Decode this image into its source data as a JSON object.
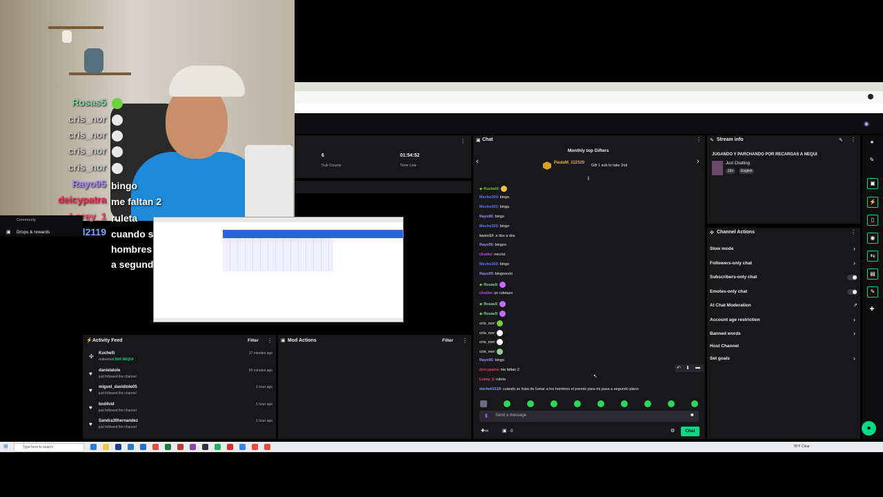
{
  "webcam_overlay": {
    "messages": [
      {
        "user": "Rosas5",
        "text": "",
        "color": "#8bd6a9"
      },
      {
        "user": "cris_nor",
        "text": "",
        "color": "#c9c9c9"
      },
      {
        "user": "cris_nor",
        "text": "",
        "color": "#c9c9c9"
      },
      {
        "user": "cris_nor",
        "text": "",
        "color": "#c9c9c9"
      },
      {
        "user": "cris_nor",
        "text": "",
        "color": "#c9c9c9"
      },
      {
        "user": "Rayo95",
        "text": "bingo",
        "color": "#a58bff"
      },
      {
        "user": "deicypatra",
        "text": "me faltan 2",
        "color": "#ff2d55"
      },
      {
        "user": "Lorey_1",
        "text": "ruleta",
        "color": "#ff4d6d"
      },
      {
        "user": "michell2119",
        "text": "cuando se trata de fumar a los hombres el premio para mi pasa a segundo plano",
        "color": "#7aa8ff"
      }
    ]
  },
  "left_nav": {
    "community": "Community",
    "drops": "Drops & rewards"
  },
  "stats": {
    "sub_counts_value": "6",
    "sub_counts_label": "Sub Counts",
    "time_live_value": "01:54:52",
    "time_live_label": "Time Live"
  },
  "chat": {
    "title": "Chat",
    "top_gifters_title": "Monthly top Gifters",
    "gifter_name": "PaulaM_112320",
    "gifter_note": "Gift 1 sub to take 2nd",
    "lines": [
      {
        "user": "Kuchelli",
        "text": "",
        "color": "#7cc83c"
      },
      {
        "user": "Mecho303",
        "text": "bingo",
        "color": "#5b7fff"
      },
      {
        "user": "Mecho303",
        "text": "bingo",
        "color": "#5b7fff"
      },
      {
        "user": "Rayo95",
        "text": "bingo",
        "color": "#a58bff"
      },
      {
        "user": "Mecho303",
        "text": "bingo",
        "color": "#5b7fff"
      },
      {
        "user": "kasio10",
        "text": "a dos a dos",
        "color": "#c9c9c9"
      },
      {
        "user": "Rayo95",
        "text": "bingoo",
        "color": "#a58bff"
      },
      {
        "user": "chatito",
        "text": "mecho",
        "color": "#c04bff"
      },
      {
        "user": "Mecho303",
        "text": "bingo",
        "color": "#5b7fff"
      },
      {
        "user": "Rayo95",
        "text": "bingooooo",
        "color": "#a58bff"
      },
      {
        "user": "Rosas5",
        "text": "",
        "color": "#8bd6a9"
      },
      {
        "user": "chatito",
        "text": "un ruletazo",
        "color": "#c04bff"
      },
      {
        "user": "Rosas5",
        "text": "",
        "color": "#8bd6a9"
      },
      {
        "user": "Rosas5",
        "text": "",
        "color": "#8bd6a9"
      },
      {
        "user": "cris_nor",
        "text": "",
        "color": "#c9c9c9"
      },
      {
        "user": "cris_nor",
        "text": "",
        "color": "#c9c9c9"
      },
      {
        "user": "cris_nor",
        "text": "",
        "color": "#c9c9c9"
      },
      {
        "user": "cris_nor",
        "text": "",
        "color": "#c9c9c9"
      },
      {
        "user": "Rayo95",
        "text": "bingo",
        "color": "#a58bff"
      },
      {
        "user": "deicypatra",
        "text": "me faltan 2",
        "color": "#ff2d55"
      },
      {
        "user": "Lorey_1",
        "text": "ruleta",
        "color": "#ff4d6d"
      },
      {
        "user": "michell2119",
        "text": "cuando se trata de fumar a los hombres el premio para mi pasa a segundo plano",
        "color": "#7aa8ff"
      }
    ],
    "input_placeholder": "Send a message",
    "points": "0",
    "chat_button": "Chat",
    "accent": "#00db84"
  },
  "stream_info": {
    "title": "Stream info",
    "stream_title": "JUGANDO Y PARCHANDO POR RECARGAS A NEQUI",
    "category": "Just Chatting",
    "tags": [
      "18+",
      "English"
    ]
  },
  "channel_actions": {
    "title": "Channel Actions",
    "items": [
      {
        "label": "Slow mode",
        "control": "chevron"
      },
      {
        "label": "Followers-only chat",
        "control": "chevron"
      },
      {
        "label": "Subscribers-only chat",
        "control": "toggle"
      },
      {
        "label": "Emotes-only chat",
        "control": "toggle"
      },
      {
        "label": "AI Chat Moderation",
        "control": "link"
      },
      {
        "label": "Account age restriction",
        "control": "chevron"
      },
      {
        "label": "Banned words",
        "control": "chevron"
      },
      {
        "label": "Host Channel",
        "control": "none"
      },
      {
        "label": "Set goals",
        "control": "chevron"
      }
    ]
  },
  "activity_feed": {
    "title": "Activity Feed",
    "filter": "Filter",
    "items": [
      {
        "name": "Kuchelli",
        "sub": "redeemed",
        "highlight": "50K NEQUI",
        "time": "37 minutes ago"
      },
      {
        "name": "danielatole",
        "sub": "just followed the channel",
        "highlight": "",
        "time": "55 minutes ago"
      },
      {
        "name": "miguel_davidtole05",
        "sub": "just followed the channel",
        "highlight": "",
        "time": "1 hour ago"
      },
      {
        "name": "bxd4vid",
        "sub": "just followed the channel",
        "highlight": "",
        "time": "1 hour ago"
      },
      {
        "name": "Sandra30hernandez",
        "sub": "just followed the channel",
        "highlight": "",
        "time": "1 hour ago"
      }
    ]
  },
  "mod_actions": {
    "title": "Mod Actions",
    "filter": "Filter"
  },
  "taskbar": {
    "search_placeholder": "Type here to search",
    "weather": "78°F Clear"
  }
}
